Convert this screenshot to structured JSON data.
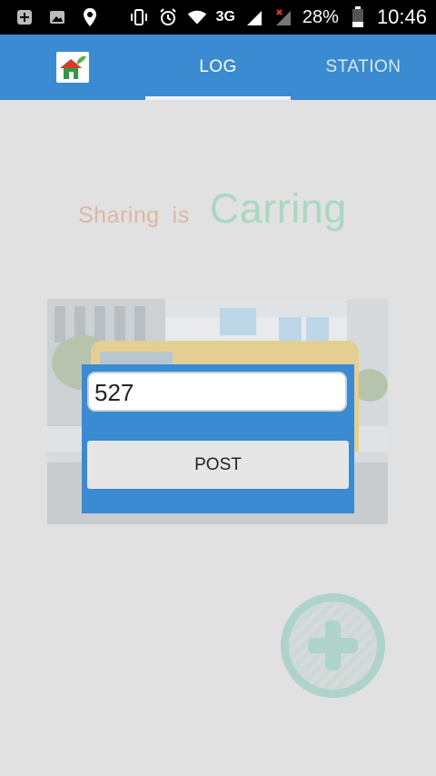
{
  "status_bar": {
    "battery_percent": "28%",
    "network_label": "3G",
    "time": "10:46",
    "icons": [
      "add-box-icon",
      "image-icon",
      "location-icon",
      "vibrate-icon",
      "alarm-icon",
      "wifi-icon",
      "signal-icon",
      "signal-no-data-icon",
      "battery-icon"
    ]
  },
  "tabs": [
    {
      "label": "LOG",
      "selected": true
    },
    {
      "label": "STATION",
      "selected": false
    }
  ],
  "slogan": {
    "word1": "Sharing",
    "word2": "is",
    "word3": "Carring"
  },
  "dialog": {
    "input_value": "527",
    "button_label": "POST"
  },
  "fab_icon": "add-circle-icon",
  "colors": {
    "primary": "#3a8bd2",
    "background": "#e1e1e1",
    "slogan_small": "#dcb7a3",
    "slogan_big": "#a8d9c0",
    "fab": "#aed3cb"
  }
}
